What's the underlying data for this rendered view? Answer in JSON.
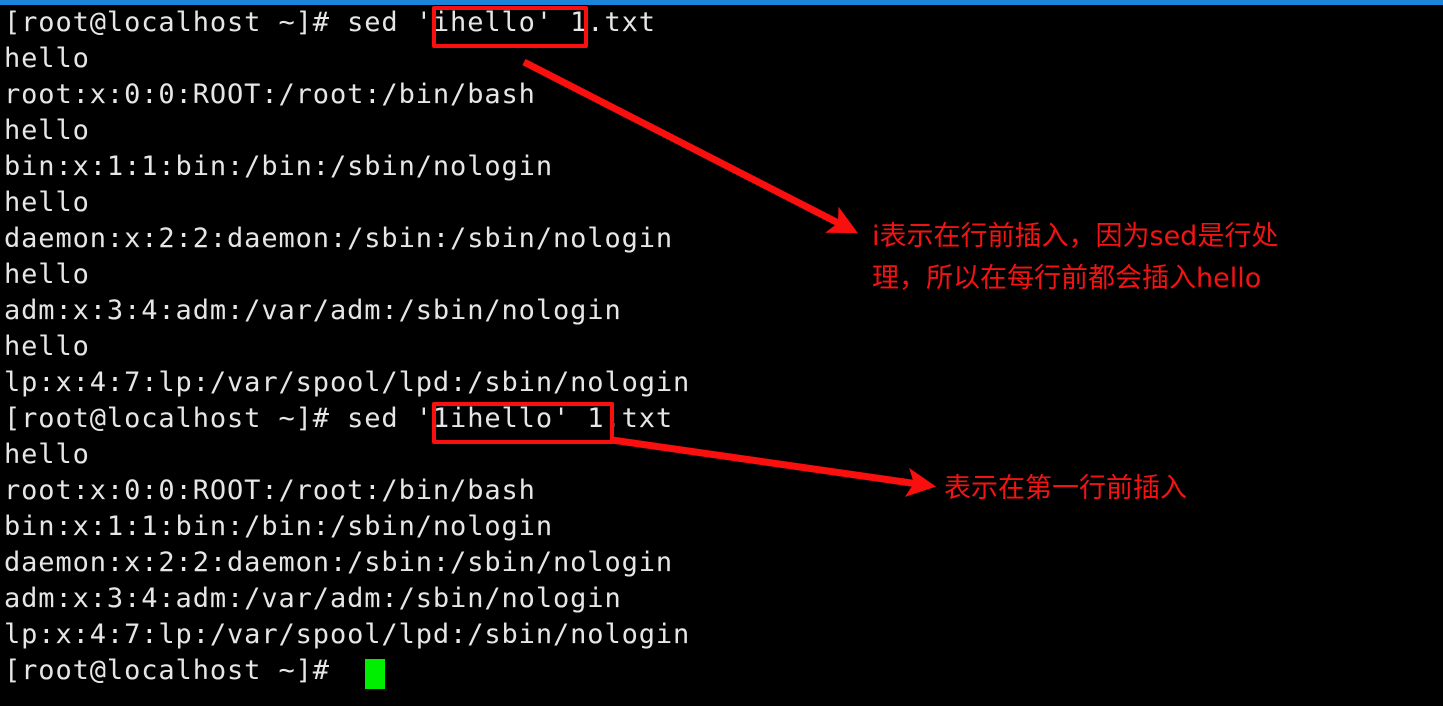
{
  "window": {
    "titlebar_color": "#1c84d8",
    "background_color": "#000000",
    "foreground_color": "#e6e6e6",
    "cursor_color": "#00ef00",
    "annotation_color": "#f21313"
  },
  "terminal": {
    "prompt": "[root@localhost ~]# ",
    "lines": [
      {
        "id": "line-01",
        "text": "[root@localhost ~]# sed 'ihello' 1.txt",
        "kind": "command"
      },
      {
        "id": "line-02",
        "text": "hello",
        "kind": "output"
      },
      {
        "id": "line-03",
        "text": "root:x:0:0:ROOT:/root:/bin/bash",
        "kind": "output"
      },
      {
        "id": "line-04",
        "text": "hello",
        "kind": "output"
      },
      {
        "id": "line-05",
        "text": "bin:x:1:1:bin:/bin:/sbin/nologin",
        "kind": "output"
      },
      {
        "id": "line-06",
        "text": "hello",
        "kind": "output"
      },
      {
        "id": "line-07",
        "text": "daemon:x:2:2:daemon:/sbin:/sbin/nologin",
        "kind": "output"
      },
      {
        "id": "line-08",
        "text": "hello",
        "kind": "output"
      },
      {
        "id": "line-09",
        "text": "adm:x:3:4:adm:/var/adm:/sbin/nologin",
        "kind": "output"
      },
      {
        "id": "line-10",
        "text": "hello",
        "kind": "output"
      },
      {
        "id": "line-11",
        "text": "lp:x:4:7:lp:/var/spool/lpd:/sbin/nologin",
        "kind": "output"
      },
      {
        "id": "line-12",
        "text": "[root@localhost ~]# sed '1ihello' 1.txt",
        "kind": "command"
      },
      {
        "id": "line-13",
        "text": "hello",
        "kind": "output"
      },
      {
        "id": "line-14",
        "text": "root:x:0:0:ROOT:/root:/bin/bash",
        "kind": "output"
      },
      {
        "id": "line-15",
        "text": "bin:x:1:1:bin:/bin:/sbin/nologin",
        "kind": "output"
      },
      {
        "id": "line-16",
        "text": "daemon:x:2:2:daemon:/sbin:/sbin/nologin",
        "kind": "output"
      },
      {
        "id": "line-17",
        "text": "adm:x:3:4:adm:/var/adm:/sbin/nologin",
        "kind": "output"
      },
      {
        "id": "line-18",
        "text": "lp:x:4:7:lp:/var/spool/lpd:/sbin/nologin",
        "kind": "output"
      },
      {
        "id": "line-19",
        "text": "[root@localhost ~]# ",
        "kind": "prompt"
      }
    ]
  },
  "highlights": [
    {
      "id": "box-ihello",
      "label": "'ihello'"
    },
    {
      "id": "box-1ihello",
      "label": "'1ihello'"
    }
  ],
  "annotations": [
    {
      "id": "annot-1",
      "text": "i表示在行前插入，因为sed是行处\n理，所以在每行前都会插入hello"
    },
    {
      "id": "annot-2",
      "text": "表示在第一行前插入"
    }
  ]
}
